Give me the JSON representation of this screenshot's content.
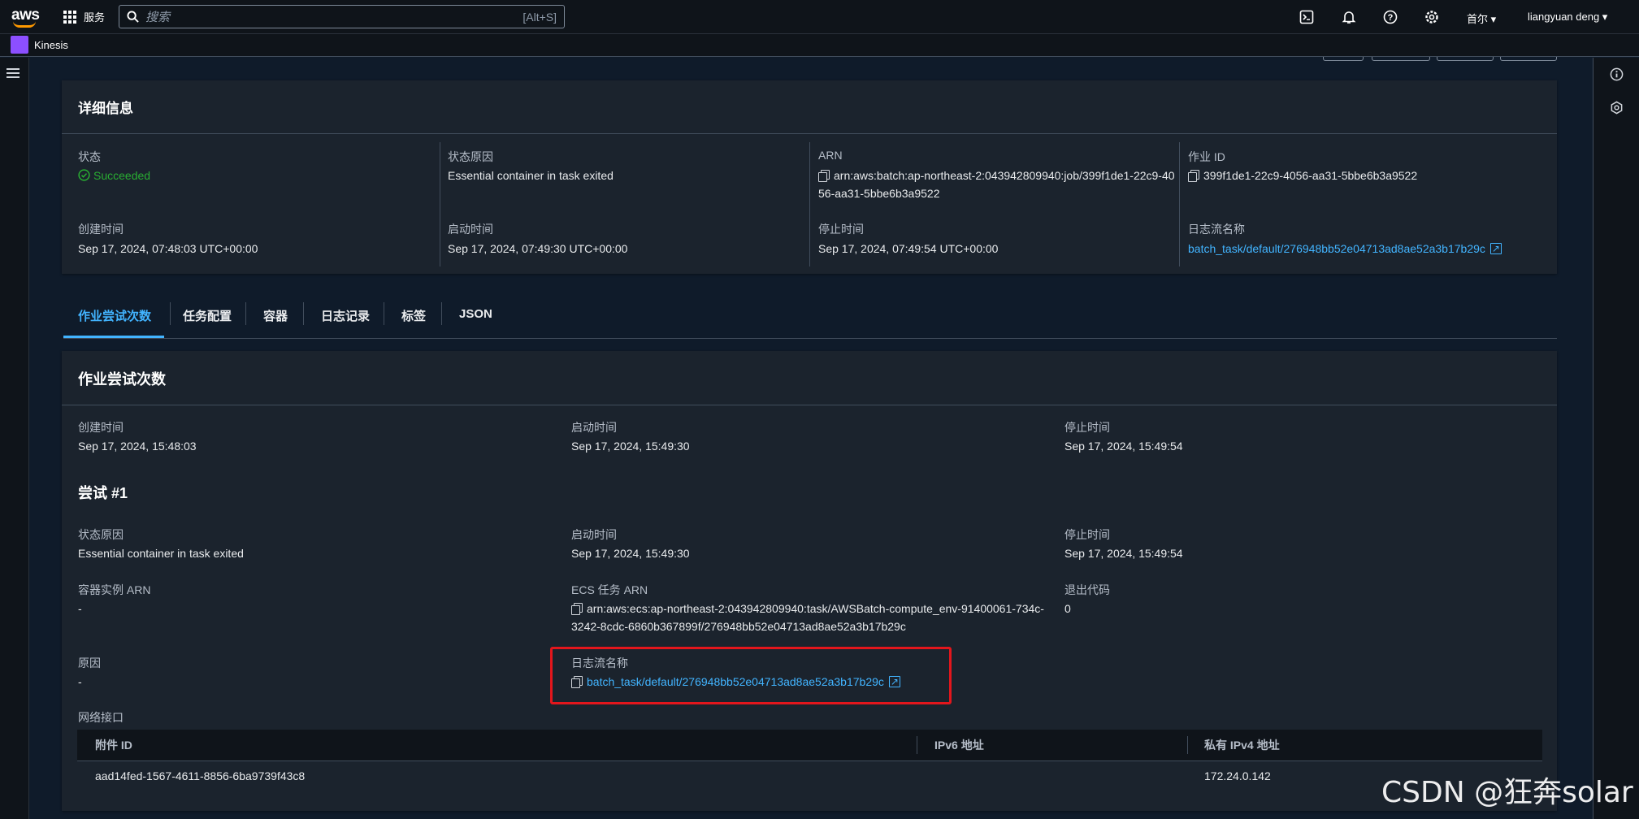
{
  "topbar": {
    "logo_text": "aws",
    "services": "服务",
    "search_placeholder": "搜索",
    "search_shortcut": "[Alt+S]",
    "region": "首尔 ▾",
    "user": "liangyuan deng ▾"
  },
  "service_bar": {
    "name": "Kinesis"
  },
  "details": {
    "title": "详细信息",
    "status_label": "状态",
    "status_value": "Succeeded",
    "reason_label": "状态原因",
    "reason_value": "Essential container in task exited",
    "arn_label": "ARN",
    "arn_value": "arn:aws:batch:ap-northeast-2:043942809940:job/399f1de1-22c9-4056-aa31-5bbe6b3a9522",
    "jobid_label": "作业 ID",
    "jobid_value": "399f1de1-22c9-4056-aa31-5bbe6b3a9522",
    "created_label": "创建时间",
    "created_value": "Sep 17, 2024, 07:48:03 UTC+00:00",
    "started_label": "启动时间",
    "started_value": "Sep 17, 2024, 07:49:30 UTC+00:00",
    "stopped_label": "停止时间",
    "stopped_value": "Sep 17, 2024, 07:49:54 UTC+00:00",
    "logstream_label": "日志流名称",
    "logstream_value": "batch_task/default/276948bb52e04713ad8ae52a3b17b29c"
  },
  "tabs": [
    "作业尝试次数",
    "任务配置",
    "容器",
    "日志记录",
    "标签",
    "JSON"
  ],
  "attempts": {
    "title": "作业尝试次数",
    "created_label": "创建时间",
    "created_value": "Sep 17, 2024, 15:48:03",
    "started_label": "启动时间",
    "started_value": "Sep 17, 2024, 15:49:30",
    "stopped_label": "停止时间",
    "stopped_value": "Sep 17, 2024, 15:49:54",
    "attempt_title": "尝试 #1",
    "a_reason_label": "状态原因",
    "a_reason_value": "Essential container in task exited",
    "a_started_label": "启动时间",
    "a_started_value": "Sep 17, 2024, 15:49:30",
    "a_stopped_label": "停止时间",
    "a_stopped_value": "Sep 17, 2024, 15:49:54",
    "container_arn_label": "容器实例 ARN",
    "container_arn_value": "-",
    "ecs_arn_label": "ECS 任务 ARN",
    "ecs_arn_value": "arn:aws:ecs:ap-northeast-2:043942809940:task/AWSBatch-compute_env-91400061-734c-3242-8cdc-6860b367899f/276948bb52e04713ad8ae52a3b17b29c",
    "exit_code_label": "退出代码",
    "exit_code_value": "0",
    "cause_label": "原因",
    "cause_value": "-",
    "logstream_label": "日志流名称",
    "logstream_value": "batch_task/default/276948bb52e04713ad8ae52a3b17b29c",
    "network_label": "网络接口",
    "table": {
      "headers": [
        "附件 ID",
        "IPv6 地址",
        "私有 IPv4 地址"
      ],
      "rows": [
        [
          "aad14fed-1567-4611-8856-6ba9739f43c8",
          "",
          "172.24.0.142"
        ]
      ]
    }
  },
  "watermark": "CSDN @狂奔solar",
  "colors": {
    "link": "#42b4ff",
    "success": "#29ad32",
    "highlight": "#e3161c"
  }
}
